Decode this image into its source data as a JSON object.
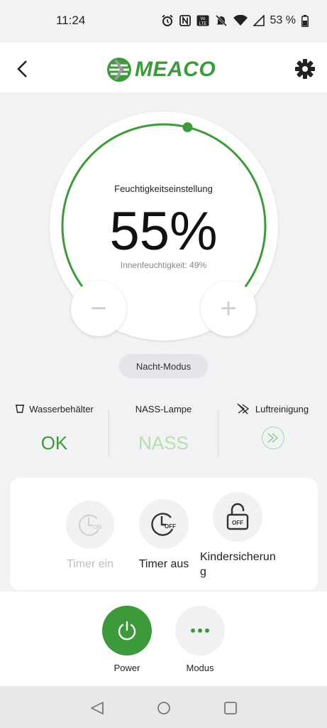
{
  "status": {
    "time": "11:24",
    "battery": "53 %",
    "icons": [
      "alarm-icon",
      "nfc-icon",
      "volte-icon",
      "mute-icon",
      "wifi-icon",
      "signal-icon",
      "battery-icon"
    ]
  },
  "header": {
    "brand": "MEACO",
    "back_icon": "back-arrow-icon",
    "settings_icon": "gear-icon"
  },
  "dial": {
    "label": "Feuchtigkeitseinstellung",
    "value": "55%",
    "sub": "Innenfeuchtigkeit: 49%",
    "value_fraction": 0.55,
    "minus": "−",
    "plus": "+"
  },
  "night_mode": {
    "label": "Nacht-Modus"
  },
  "info": {
    "tank": {
      "title": "Wasserbehälter",
      "value": "OK",
      "icon": "water-tank-icon"
    },
    "lamp": {
      "title": "NASS-Lampe",
      "value": "NASS"
    },
    "purify": {
      "title": "Luftreinigung",
      "icon": "purification-icon"
    }
  },
  "controls": {
    "timer_on": {
      "label": "Timer ein",
      "icon_text": "ON"
    },
    "timer_off": {
      "label": "Timer aus",
      "icon_text": "OFF"
    },
    "child_lock": {
      "label": "Kindersicherung",
      "icon_text": "OFF"
    }
  },
  "bottom": {
    "power": {
      "label": "Power"
    },
    "mode": {
      "label": "Modus"
    }
  },
  "colors": {
    "accent": "#3d9a3a",
    "accent_light": "#b9dcb5",
    "background": "#f1f2f4"
  }
}
